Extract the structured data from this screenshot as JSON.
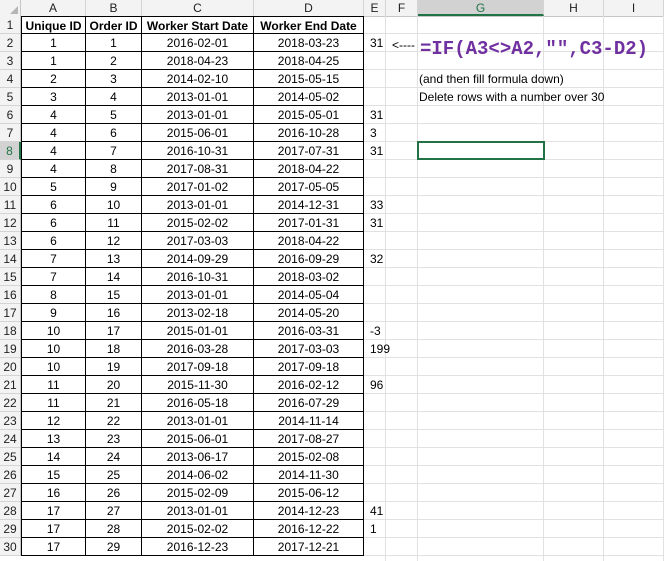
{
  "columns": [
    "A",
    "B",
    "C",
    "D",
    "E",
    "F",
    "G",
    "H",
    "I"
  ],
  "headers": [
    "Unique ID",
    "Order ID",
    "Worker Start Date",
    "Worker End Date"
  ],
  "rows": [
    {
      "id": "1",
      "order": "1",
      "start": "2016-02-01",
      "end": "2018-03-23",
      "e": "31"
    },
    {
      "id": "1",
      "order": "2",
      "start": "2018-04-23",
      "end": "2018-04-25",
      "e": ""
    },
    {
      "id": "2",
      "order": "3",
      "start": "2014-02-10",
      "end": "2015-05-15",
      "e": ""
    },
    {
      "id": "3",
      "order": "4",
      "start": "2013-01-01",
      "end": "2014-05-02",
      "e": ""
    },
    {
      "id": "4",
      "order": "5",
      "start": "2013-01-01",
      "end": "2015-05-01",
      "e": "31"
    },
    {
      "id": "4",
      "order": "6",
      "start": "2015-06-01",
      "end": "2016-10-28",
      "e": "3"
    },
    {
      "id": "4",
      "order": "7",
      "start": "2016-10-31",
      "end": "2017-07-31",
      "e": "31"
    },
    {
      "id": "4",
      "order": "8",
      "start": "2017-08-31",
      "end": "2018-04-22",
      "e": ""
    },
    {
      "id": "5",
      "order": "9",
      "start": "2017-01-02",
      "end": "2017-05-05",
      "e": ""
    },
    {
      "id": "6",
      "order": "10",
      "start": "2013-01-01",
      "end": "2014-12-31",
      "e": "33"
    },
    {
      "id": "6",
      "order": "11",
      "start": "2015-02-02",
      "end": "2017-01-31",
      "e": "31"
    },
    {
      "id": "6",
      "order": "12",
      "start": "2017-03-03",
      "end": "2018-04-22",
      "e": ""
    },
    {
      "id": "7",
      "order": "13",
      "start": "2014-09-29",
      "end": "2016-09-29",
      "e": "32"
    },
    {
      "id": "7",
      "order": "14",
      "start": "2016-10-31",
      "end": "2018-03-02",
      "e": ""
    },
    {
      "id": "8",
      "order": "15",
      "start": "2013-01-01",
      "end": "2014-05-04",
      "e": ""
    },
    {
      "id": "9",
      "order": "16",
      "start": "2013-02-18",
      "end": "2014-05-20",
      "e": ""
    },
    {
      "id": "10",
      "order": "17",
      "start": "2015-01-01",
      "end": "2016-03-31",
      "e": "-3"
    },
    {
      "id": "10",
      "order": "18",
      "start": "2016-03-28",
      "end": "2017-03-03",
      "e": "199"
    },
    {
      "id": "10",
      "order": "19",
      "start": "2017-09-18",
      "end": "2017-09-18",
      "e": ""
    },
    {
      "id": "11",
      "order": "20",
      "start": "2015-11-30",
      "end": "2016-02-12",
      "e": "96"
    },
    {
      "id": "11",
      "order": "21",
      "start": "2016-05-18",
      "end": "2016-07-29",
      "e": ""
    },
    {
      "id": "12",
      "order": "22",
      "start": "2013-01-01",
      "end": "2014-11-14",
      "e": ""
    },
    {
      "id": "13",
      "order": "23",
      "start": "2015-06-01",
      "end": "2017-08-27",
      "e": ""
    },
    {
      "id": "14",
      "order": "24",
      "start": "2013-06-17",
      "end": "2015-02-08",
      "e": ""
    },
    {
      "id": "15",
      "order": "25",
      "start": "2014-06-02",
      "end": "2014-11-30",
      "e": ""
    },
    {
      "id": "16",
      "order": "26",
      "start": "2015-02-09",
      "end": "2015-06-12",
      "e": ""
    },
    {
      "id": "17",
      "order": "27",
      "start": "2013-01-01",
      "end": "2014-12-23",
      "e": "41"
    },
    {
      "id": "17",
      "order": "28",
      "start": "2015-02-02",
      "end": "2016-12-22",
      "e": "1"
    },
    {
      "id": "17",
      "order": "29",
      "start": "2016-12-23",
      "end": "2017-12-21",
      "e": ""
    }
  ],
  "annotation": {
    "arrow": "<----",
    "formula": "=IF(A3<>A2,\"\",C3-D2)",
    "note1": "(and then fill formula down)",
    "note2": "Delete rows with a number over 30"
  },
  "selection": {
    "row": 8,
    "column": "G"
  }
}
